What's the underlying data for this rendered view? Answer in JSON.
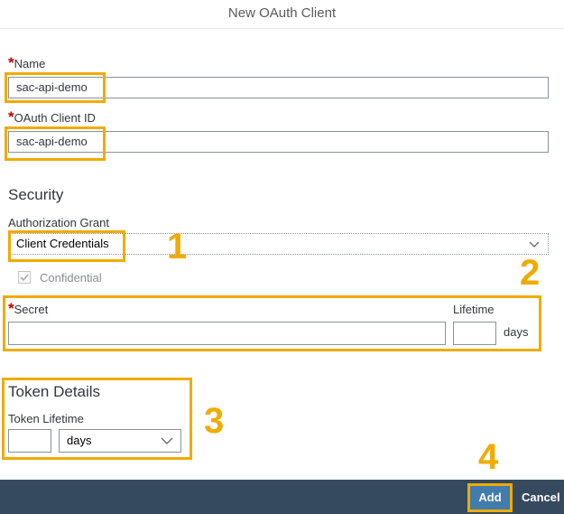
{
  "dialog": {
    "title": "New OAuth Client"
  },
  "name": {
    "label": "Name",
    "required_mark": "*",
    "value": "sac-api-demo"
  },
  "client_id": {
    "label": "OAuth Client ID",
    "required_mark": "*",
    "value": "sac-api-demo"
  },
  "security": {
    "heading": "Security",
    "grant_label": "Authorization Grant",
    "grant_value": "Client Credentials",
    "confidential_label": "Confidential",
    "confidential_checked": true,
    "secret_label": "Secret",
    "secret_required_mark": "*",
    "secret_value": "",
    "lifetime_label": "Lifetime",
    "lifetime_value": "",
    "lifetime_unit": "days"
  },
  "token": {
    "heading": "Token Details",
    "lifetime_label": "Token Lifetime",
    "lifetime_value": "",
    "unit_value": "days"
  },
  "callouts": [
    "1",
    "2",
    "3",
    "4"
  ],
  "footer": {
    "add_label": "Add",
    "cancel_label": "Cancel"
  },
  "colors": {
    "highlight": "#f0ab00",
    "footer_bg": "#354a5f",
    "add_button": "#427cac"
  },
  "icons": {
    "dropdown": "chevron-down-icon",
    "checkbox": "checkmark-icon"
  }
}
